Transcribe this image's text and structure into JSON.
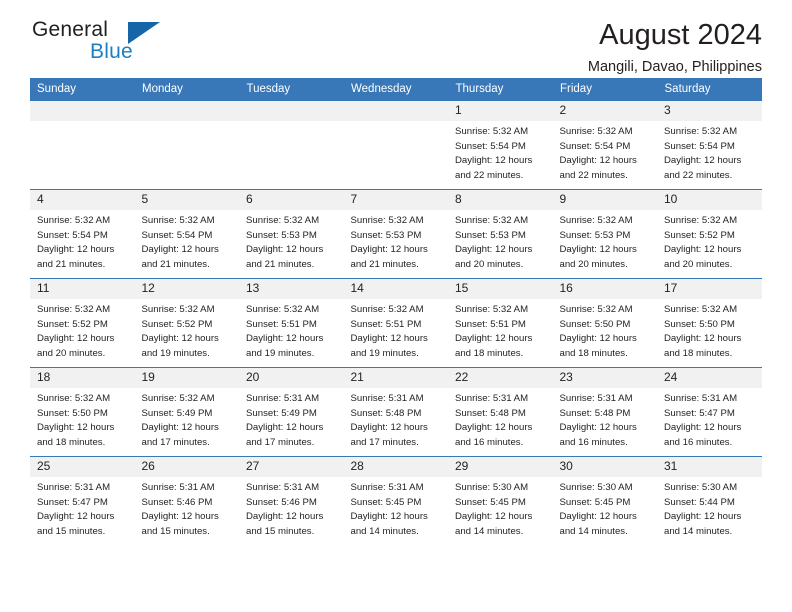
{
  "brand": {
    "word1": "General",
    "word2": "Blue",
    "triangle_color": "#1565a8",
    "accent_color": "#1b7fc4"
  },
  "header": {
    "title": "August 2024",
    "subtitle": "Mangili, Davao, Philippines",
    "header_bg": "#3878b8",
    "daynum_bg": "#f1f1f1"
  },
  "weekdays": [
    "Sunday",
    "Monday",
    "Tuesday",
    "Wednesday",
    "Thursday",
    "Friday",
    "Saturday"
  ],
  "labels": {
    "sunrise": "Sunrise:",
    "sunset": "Sunset:",
    "daylight": "Daylight:"
  },
  "weeks": [
    [
      {
        "day": "",
        "empty": true
      },
      {
        "day": "",
        "empty": true
      },
      {
        "day": "",
        "empty": true
      },
      {
        "day": "",
        "empty": true
      },
      {
        "day": "1",
        "sunrise": "Sunrise: 5:32 AM",
        "sunset": "Sunset: 5:54 PM",
        "daylight1": "Daylight: 12 hours",
        "daylight2": "and 22 minutes."
      },
      {
        "day": "2",
        "sunrise": "Sunrise: 5:32 AM",
        "sunset": "Sunset: 5:54 PM",
        "daylight1": "Daylight: 12 hours",
        "daylight2": "and 22 minutes."
      },
      {
        "day": "3",
        "sunrise": "Sunrise: 5:32 AM",
        "sunset": "Sunset: 5:54 PM",
        "daylight1": "Daylight: 12 hours",
        "daylight2": "and 22 minutes."
      }
    ],
    [
      {
        "day": "4",
        "sunrise": "Sunrise: 5:32 AM",
        "sunset": "Sunset: 5:54 PM",
        "daylight1": "Daylight: 12 hours",
        "daylight2": "and 21 minutes."
      },
      {
        "day": "5",
        "sunrise": "Sunrise: 5:32 AM",
        "sunset": "Sunset: 5:54 PM",
        "daylight1": "Daylight: 12 hours",
        "daylight2": "and 21 minutes."
      },
      {
        "day": "6",
        "sunrise": "Sunrise: 5:32 AM",
        "sunset": "Sunset: 5:53 PM",
        "daylight1": "Daylight: 12 hours",
        "daylight2": "and 21 minutes."
      },
      {
        "day": "7",
        "sunrise": "Sunrise: 5:32 AM",
        "sunset": "Sunset: 5:53 PM",
        "daylight1": "Daylight: 12 hours",
        "daylight2": "and 21 minutes."
      },
      {
        "day": "8",
        "sunrise": "Sunrise: 5:32 AM",
        "sunset": "Sunset: 5:53 PM",
        "daylight1": "Daylight: 12 hours",
        "daylight2": "and 20 minutes."
      },
      {
        "day": "9",
        "sunrise": "Sunrise: 5:32 AM",
        "sunset": "Sunset: 5:53 PM",
        "daylight1": "Daylight: 12 hours",
        "daylight2": "and 20 minutes."
      },
      {
        "day": "10",
        "sunrise": "Sunrise: 5:32 AM",
        "sunset": "Sunset: 5:52 PM",
        "daylight1": "Daylight: 12 hours",
        "daylight2": "and 20 minutes."
      }
    ],
    [
      {
        "day": "11",
        "sunrise": "Sunrise: 5:32 AM",
        "sunset": "Sunset: 5:52 PM",
        "daylight1": "Daylight: 12 hours",
        "daylight2": "and 20 minutes."
      },
      {
        "day": "12",
        "sunrise": "Sunrise: 5:32 AM",
        "sunset": "Sunset: 5:52 PM",
        "daylight1": "Daylight: 12 hours",
        "daylight2": "and 19 minutes."
      },
      {
        "day": "13",
        "sunrise": "Sunrise: 5:32 AM",
        "sunset": "Sunset: 5:51 PM",
        "daylight1": "Daylight: 12 hours",
        "daylight2": "and 19 minutes."
      },
      {
        "day": "14",
        "sunrise": "Sunrise: 5:32 AM",
        "sunset": "Sunset: 5:51 PM",
        "daylight1": "Daylight: 12 hours",
        "daylight2": "and 19 minutes."
      },
      {
        "day": "15",
        "sunrise": "Sunrise: 5:32 AM",
        "sunset": "Sunset: 5:51 PM",
        "daylight1": "Daylight: 12 hours",
        "daylight2": "and 18 minutes."
      },
      {
        "day": "16",
        "sunrise": "Sunrise: 5:32 AM",
        "sunset": "Sunset: 5:50 PM",
        "daylight1": "Daylight: 12 hours",
        "daylight2": "and 18 minutes."
      },
      {
        "day": "17",
        "sunrise": "Sunrise: 5:32 AM",
        "sunset": "Sunset: 5:50 PM",
        "daylight1": "Daylight: 12 hours",
        "daylight2": "and 18 minutes."
      }
    ],
    [
      {
        "day": "18",
        "sunrise": "Sunrise: 5:32 AM",
        "sunset": "Sunset: 5:50 PM",
        "daylight1": "Daylight: 12 hours",
        "daylight2": "and 18 minutes."
      },
      {
        "day": "19",
        "sunrise": "Sunrise: 5:32 AM",
        "sunset": "Sunset: 5:49 PM",
        "daylight1": "Daylight: 12 hours",
        "daylight2": "and 17 minutes."
      },
      {
        "day": "20",
        "sunrise": "Sunrise: 5:31 AM",
        "sunset": "Sunset: 5:49 PM",
        "daylight1": "Daylight: 12 hours",
        "daylight2": "and 17 minutes."
      },
      {
        "day": "21",
        "sunrise": "Sunrise: 5:31 AM",
        "sunset": "Sunset: 5:48 PM",
        "daylight1": "Daylight: 12 hours",
        "daylight2": "and 17 minutes."
      },
      {
        "day": "22",
        "sunrise": "Sunrise: 5:31 AM",
        "sunset": "Sunset: 5:48 PM",
        "daylight1": "Daylight: 12 hours",
        "daylight2": "and 16 minutes."
      },
      {
        "day": "23",
        "sunrise": "Sunrise: 5:31 AM",
        "sunset": "Sunset: 5:48 PM",
        "daylight1": "Daylight: 12 hours",
        "daylight2": "and 16 minutes."
      },
      {
        "day": "24",
        "sunrise": "Sunrise: 5:31 AM",
        "sunset": "Sunset: 5:47 PM",
        "daylight1": "Daylight: 12 hours",
        "daylight2": "and 16 minutes."
      }
    ],
    [
      {
        "day": "25",
        "sunrise": "Sunrise: 5:31 AM",
        "sunset": "Sunset: 5:47 PM",
        "daylight1": "Daylight: 12 hours",
        "daylight2": "and 15 minutes."
      },
      {
        "day": "26",
        "sunrise": "Sunrise: 5:31 AM",
        "sunset": "Sunset: 5:46 PM",
        "daylight1": "Daylight: 12 hours",
        "daylight2": "and 15 minutes."
      },
      {
        "day": "27",
        "sunrise": "Sunrise: 5:31 AM",
        "sunset": "Sunset: 5:46 PM",
        "daylight1": "Daylight: 12 hours",
        "daylight2": "and 15 minutes."
      },
      {
        "day": "28",
        "sunrise": "Sunrise: 5:31 AM",
        "sunset": "Sunset: 5:45 PM",
        "daylight1": "Daylight: 12 hours",
        "daylight2": "and 14 minutes."
      },
      {
        "day": "29",
        "sunrise": "Sunrise: 5:30 AM",
        "sunset": "Sunset: 5:45 PM",
        "daylight1": "Daylight: 12 hours",
        "daylight2": "and 14 minutes."
      },
      {
        "day": "30",
        "sunrise": "Sunrise: 5:30 AM",
        "sunset": "Sunset: 5:45 PM",
        "daylight1": "Daylight: 12 hours",
        "daylight2": "and 14 minutes."
      },
      {
        "day": "31",
        "sunrise": "Sunrise: 5:30 AM",
        "sunset": "Sunset: 5:44 PM",
        "daylight1": "Daylight: 12 hours",
        "daylight2": "and 14 minutes."
      }
    ]
  ]
}
